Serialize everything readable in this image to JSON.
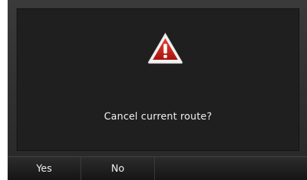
{
  "dialog": {
    "message": "Cancel current route?",
    "icon": "warning-icon",
    "icon_color": "#c8231f"
  },
  "buttons": {
    "yes_label": "Yes",
    "no_label": "No"
  },
  "colors": {
    "background": "#1f1f1f",
    "text": "#f2f2f2"
  }
}
